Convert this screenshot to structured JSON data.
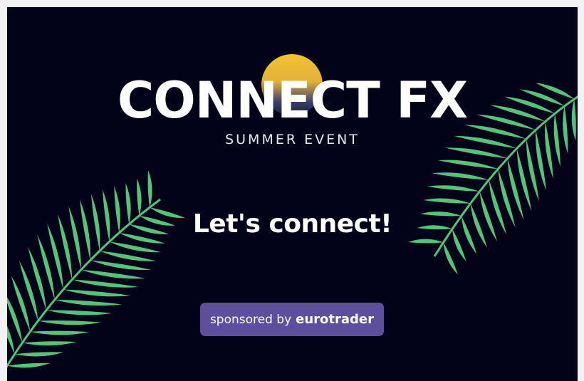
{
  "brand": {
    "title": "CONNECT FX",
    "subtitle": "SUMMER EVENT"
  },
  "headline": "Let's connect!",
  "sponsor": {
    "prefix": "sponsored by",
    "company": "eurotrader"
  },
  "colors": {
    "background": "#020318",
    "page_margin": "#f2f2f4",
    "sun": "#f2c330",
    "leaf": "#56c27a",
    "sponsor_button": "#5e4f9e"
  },
  "icons": [
    "sun-icon",
    "palm-leaf-icon"
  ]
}
